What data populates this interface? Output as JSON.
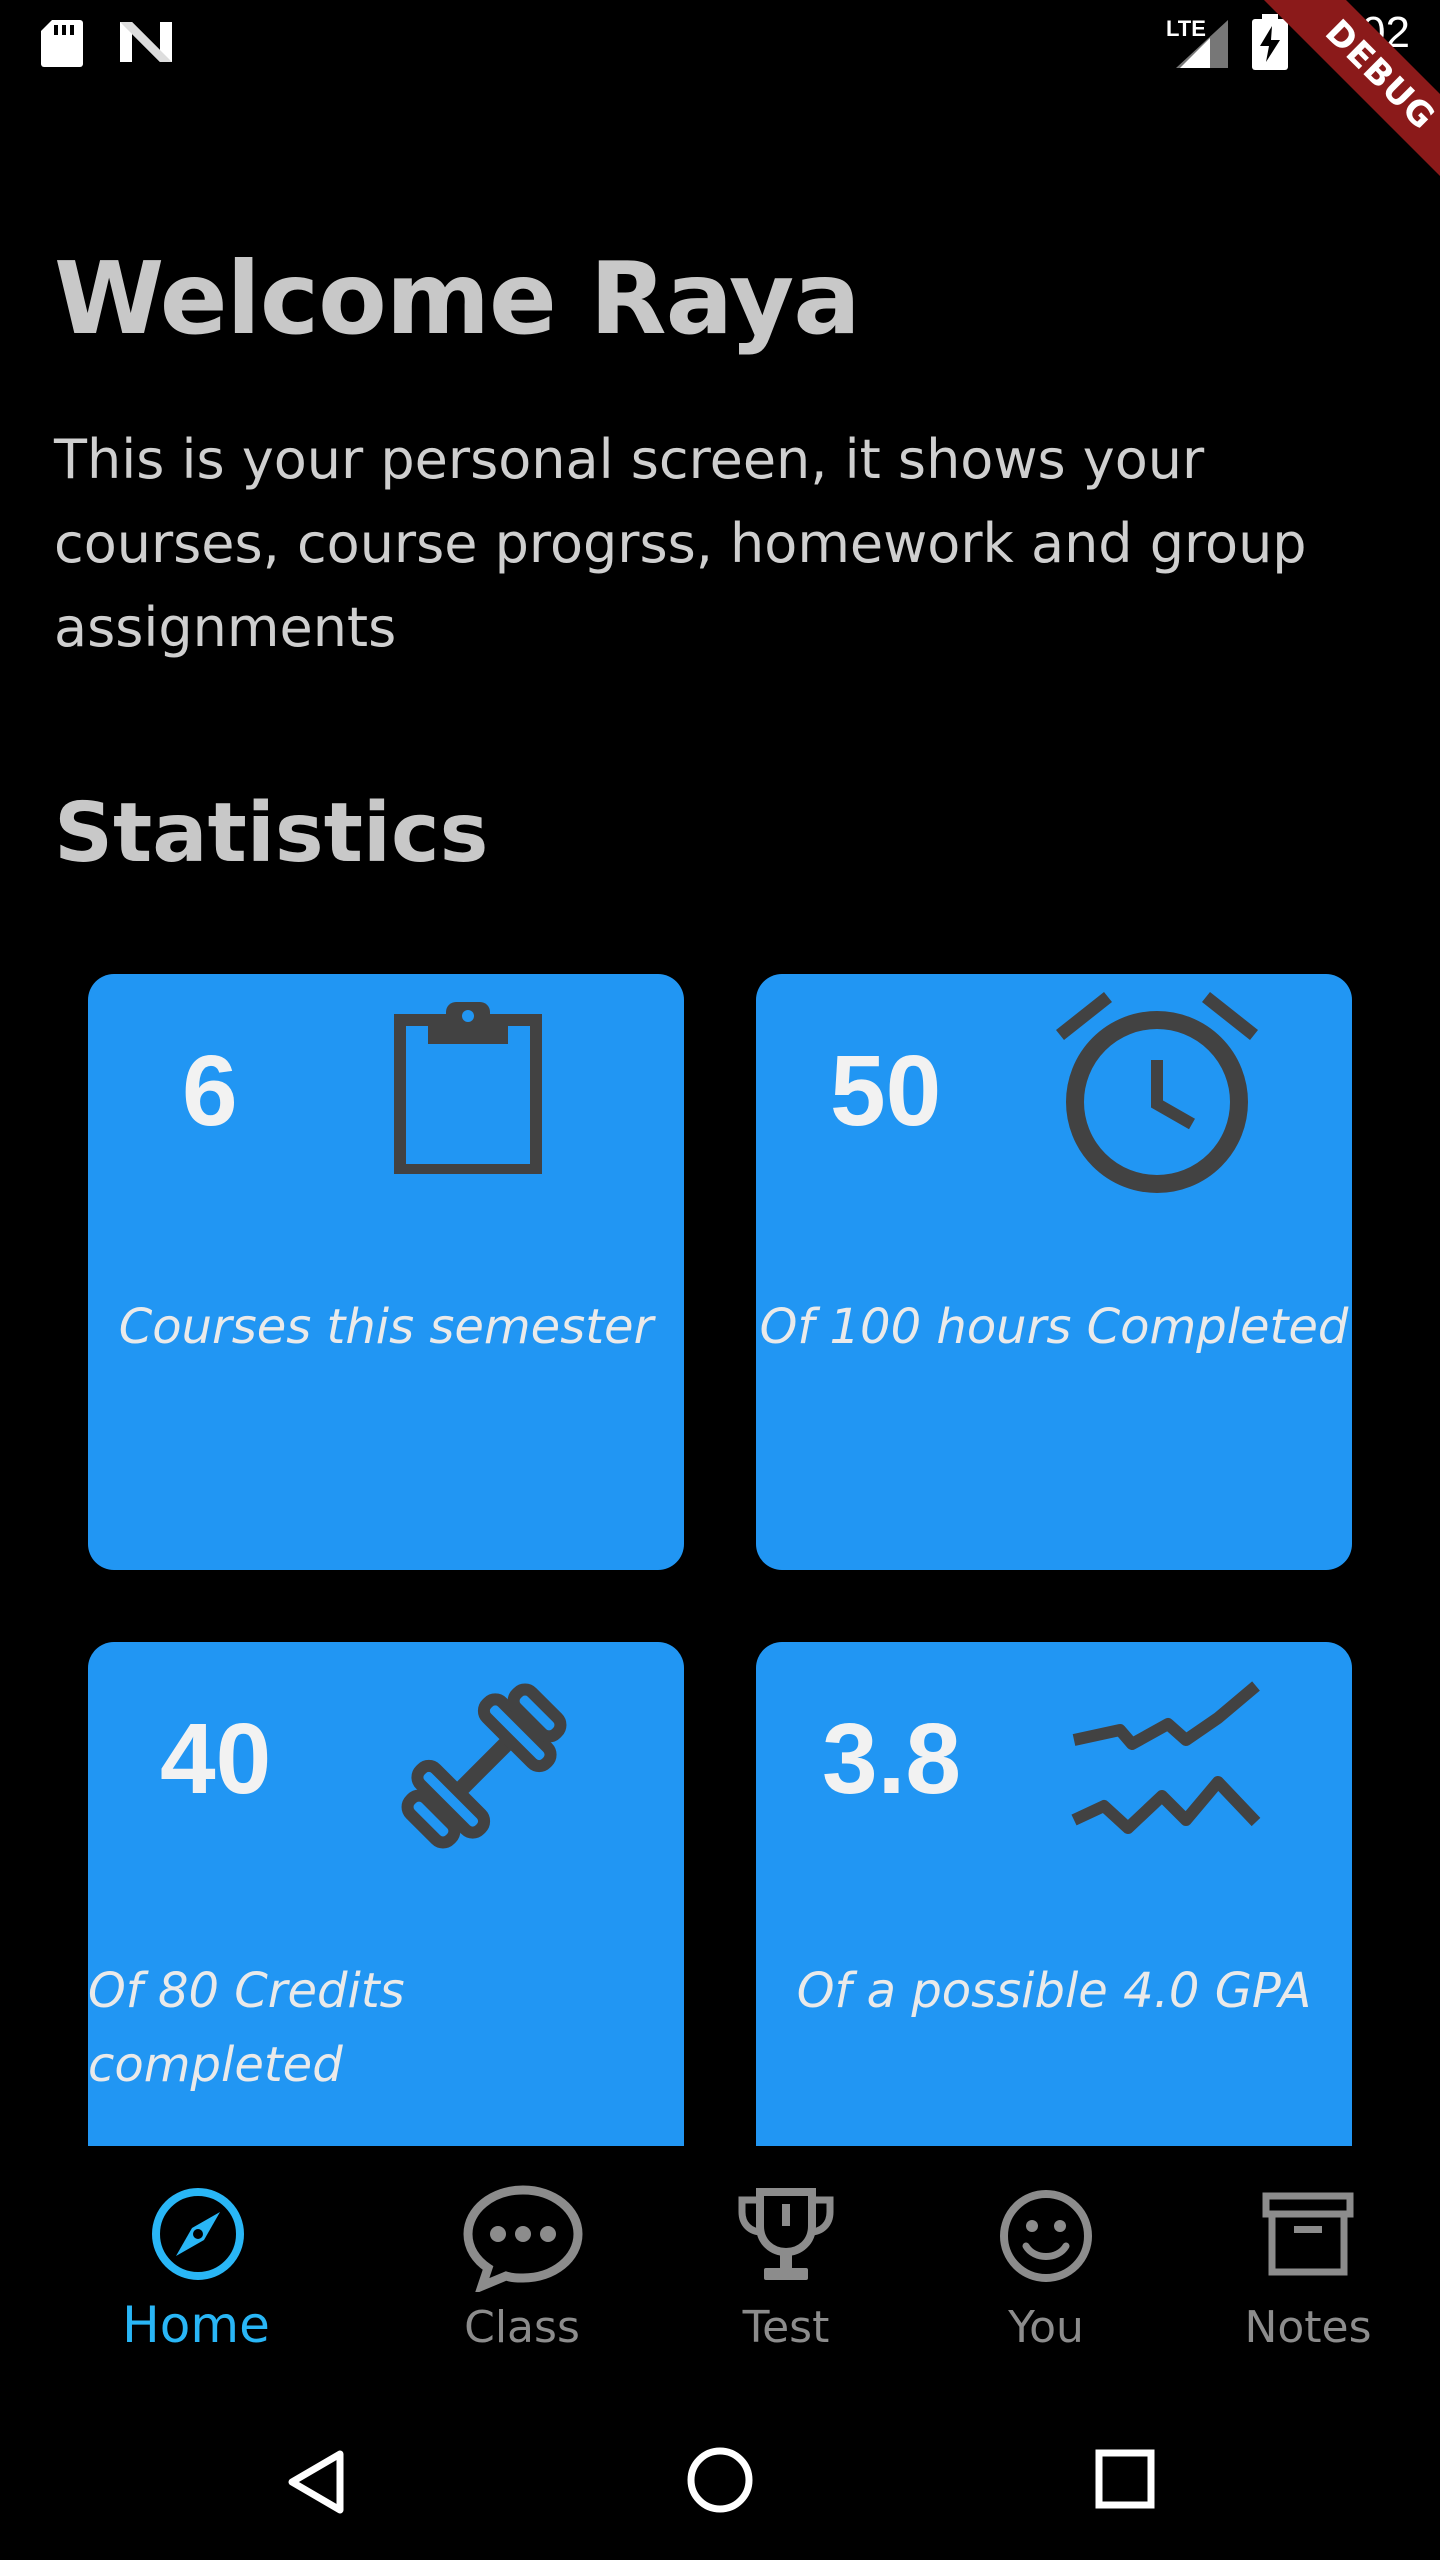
{
  "status_bar": {
    "time": "8:02",
    "network": "LTE",
    "icons": [
      "sd-card-icon",
      "n-logo-icon",
      "signal-icon",
      "battery-charging-icon"
    ]
  },
  "debug_banner": "DEBUG",
  "header": {
    "title": "Welcome Raya",
    "description": "This is your personal screen, it shows your courses, course progrss, homework and group assignments"
  },
  "statistics": {
    "title": "Statistics",
    "cards": [
      {
        "value": "6",
        "label": "Courses this semester",
        "icon": "clipboard-icon"
      },
      {
        "value": "50",
        "label": "Of 100 hours Completed",
        "icon": "alarm-clock-icon"
      },
      {
        "value": "40",
        "label": "Of 80 Credits completed",
        "icon": "dumbbell-icon"
      },
      {
        "value": "3.8",
        "label": "Of a possible 4.0 GPA",
        "icon": "trend-lines-icon"
      }
    ]
  },
  "bottom_nav": {
    "items": [
      {
        "label": "Home",
        "icon": "compass-icon",
        "active": true
      },
      {
        "label": "Class",
        "icon": "chat-bubble-icon",
        "active": false
      },
      {
        "label": "Test",
        "icon": "trophy-icon",
        "active": false
      },
      {
        "label": "You",
        "icon": "smiley-icon",
        "active": false
      },
      {
        "label": "Notes",
        "icon": "archive-box-icon",
        "active": false
      }
    ]
  },
  "system_nav": {
    "buttons": [
      "back-icon",
      "home-circle-icon",
      "recents-square-icon"
    ]
  },
  "colors": {
    "background": "#000000",
    "card": "#2196f3",
    "icon_dark": "#424242",
    "active": "#29b6f6",
    "inactive": "#8c8c8c",
    "debug": "#8b1a1a"
  }
}
